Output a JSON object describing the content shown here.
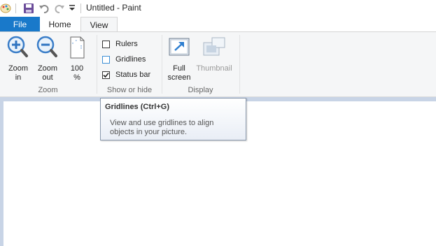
{
  "window": {
    "title": "Untitled - Paint"
  },
  "quick_access": {
    "icons": [
      "paint-app-icon",
      "save-icon",
      "undo-icon",
      "redo-icon",
      "customize-dropdown-icon"
    ]
  },
  "tabs": [
    {
      "label": "File",
      "active": false
    },
    {
      "label": "Home",
      "active": false
    },
    {
      "label": "View",
      "active": true
    }
  ],
  "ribbon": {
    "zoom": {
      "label": "Zoom",
      "buttons": [
        {
          "line1": "Zoom",
          "line2": "in",
          "icon": "zoom-in-icon"
        },
        {
          "line1": "Zoom",
          "line2": "out",
          "icon": "zoom-out-icon"
        },
        {
          "line1": "100",
          "line2": "%",
          "icon": "zoom-100-icon"
        }
      ]
    },
    "show_hide": {
      "label": "Show or hide",
      "checkboxes": [
        {
          "label": "Rulers",
          "checked": false
        },
        {
          "label": "Gridlines",
          "checked": false
        },
        {
          "label": "Status bar",
          "checked": true
        }
      ]
    },
    "display": {
      "label": "Display",
      "buttons": [
        {
          "line1": "Full",
          "line2": "screen",
          "icon": "full-screen-icon",
          "enabled": true
        },
        {
          "line1": "Thumbnail",
          "line2": "",
          "icon": "thumbnail-icon",
          "enabled": false
        }
      ]
    }
  },
  "tooltip": {
    "title": "Gridlines (Ctrl+G)",
    "body": "View and use gridlines to align objects in your picture."
  },
  "colors": {
    "file_tab": "#1979ca",
    "ribbon_bg": "#f5f6f7",
    "workspace_bg": "#c8d4e6"
  }
}
